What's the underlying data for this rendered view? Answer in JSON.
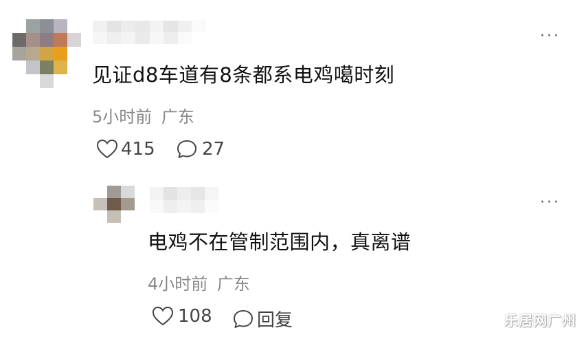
{
  "comments": [
    {
      "text": "见证d8车道有8条都系电鸡噶时刻",
      "time": "5小时前",
      "location": "广东",
      "likes": "415",
      "replies": "27"
    },
    {
      "text": "电鸡不在管制范围内，真离谱",
      "time": "4小时前",
      "location": "广东",
      "likes": "108",
      "reply_label": "回复"
    }
  ],
  "more_label": "···",
  "watermark": "乐居网广州",
  "icons": {
    "like": "heart-icon",
    "comment": "speech-bubble-icon",
    "more": "more-dots-icon"
  }
}
